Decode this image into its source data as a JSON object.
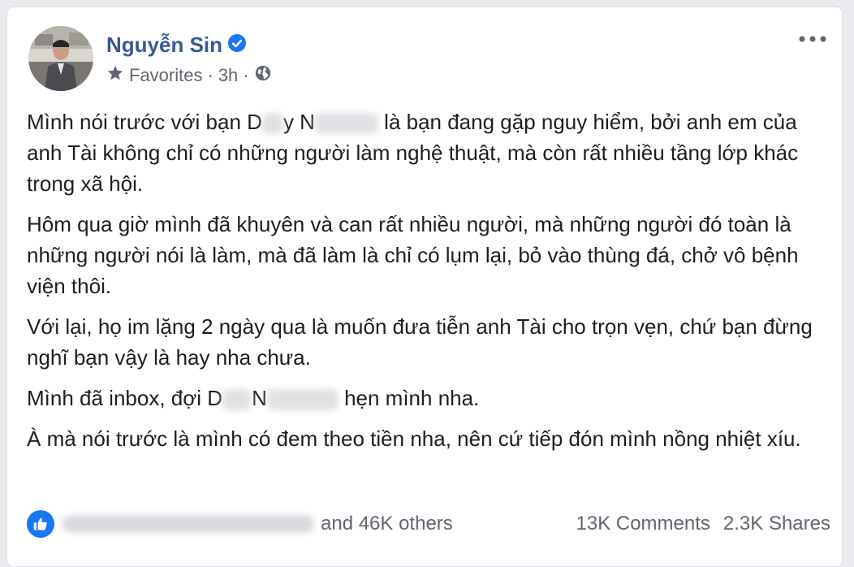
{
  "post": {
    "author": "Nguyễn Sin",
    "audience": "Favorites",
    "separator": "·",
    "time": "3h",
    "paragraphs": {
      "p1_a": "Mình nói trước với bạn D",
      "p1_b": "y N",
      "p1_c": " là bạn đang gặp nguy hiểm, bởi anh em của anh Tài không chỉ có những người làm nghệ thuật, mà còn rất nhiều tầng lớp khác trong xã hội.",
      "p2": "Hôm qua giờ mình đã khuyên và can rất nhiều người, mà những người đó toàn là những người nói là làm, mà đã làm là chỉ có lụm lại, bỏ vào thùng đá, chở vô bệnh viện thôi.",
      "p3": "Với lại, họ im lặng 2 ngày qua là muốn đưa tiễn anh Tài cho trọn vẹn, chứ bạn đừng nghĩ bạn vậy là hay nha chưa.",
      "p4_a": "Mình đã inbox, đợi D",
      "p4_b": "N",
      "p4_c": " hẹn mình nha.",
      "p5": "À mà nói trước là mình có đem theo tiền nha, nên cứ tiếp đón mình nồng nhiệt xíu."
    }
  },
  "reactions": {
    "others": "and 46K others",
    "comments": "13K Comments",
    "shares": "2.3K Shares"
  },
  "icons": {
    "verified": "verified-badge-icon",
    "audience": "star-icon",
    "privacy": "globe-icon",
    "more": "more-options-icon",
    "like": "like-thumb-icon"
  },
  "colors": {
    "author_link": "#385898",
    "accent": "#1877f2",
    "text": "#1c1e21",
    "muted": "#606770"
  }
}
